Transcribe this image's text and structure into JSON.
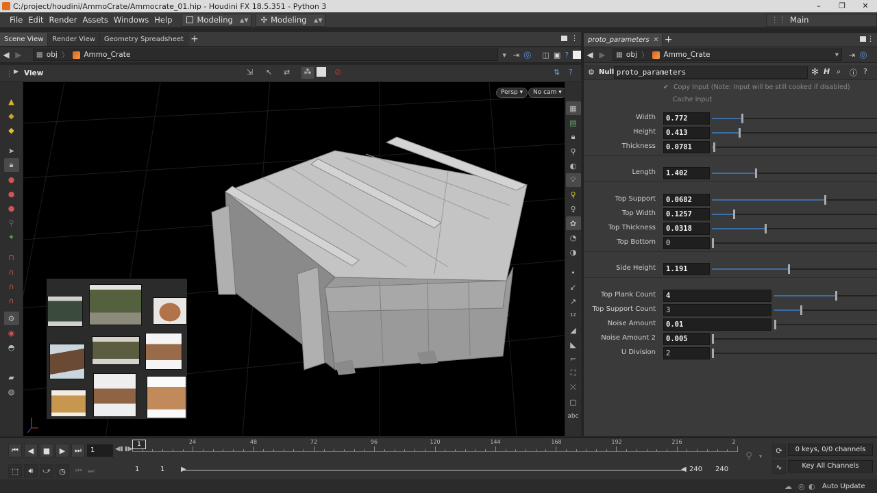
{
  "titlebar": {
    "title": "C:/project/houdini/AmmoCrate/Ammocrate_01.hip - Houdini FX 18.5.351 - Python 3",
    "min": "–",
    "max": "❐",
    "close": "✕"
  },
  "menubar": {
    "items": [
      "File",
      "Edit",
      "Render",
      "Assets",
      "Windows",
      "Help"
    ],
    "desktop": "Modeling",
    "shelf": "Modeling",
    "main": "Main"
  },
  "scene_tabs": [
    "Scene View",
    "Render View",
    "Geometry Spreadsheet"
  ],
  "scene_path": {
    "root": "obj",
    "node": "Ammo_Crate"
  },
  "view": {
    "label": "View",
    "persp": "Persp ▾",
    "cam": "No cam ▾"
  },
  "param_tab": "proto_parameters",
  "param_path": {
    "root": "obj",
    "node": "Ammo_Crate"
  },
  "node": {
    "type": "Null",
    "name": "proto_parameters"
  },
  "toggles": {
    "copy_input": "Copy Input (Note: Input will be still cooked if disabled)",
    "cache_input": "Cache Input"
  },
  "params": {
    "width": {
      "label": "Width",
      "value": "0.772",
      "frac": 0.18
    },
    "height": {
      "label": "Height",
      "value": "0.413",
      "frac": 0.16
    },
    "thickness": {
      "label": "Thickness",
      "value": "0.0781",
      "frac": 0.01
    },
    "length": {
      "label": "Length",
      "value": "1.402",
      "frac": 0.26
    },
    "top_support": {
      "label": "Top Support",
      "value": "0.0682",
      "frac": 0.68
    },
    "top_width": {
      "label": "Top Width",
      "value": "0.1257",
      "frac": 0.13
    },
    "top_thickness": {
      "label": "Top Thickness",
      "value": "0.0318",
      "frac": 0.32
    },
    "top_bottom": {
      "label": "Top Bottom",
      "value": "0",
      "frac": 0.0
    },
    "side_height": {
      "label": "Side Height",
      "value": "1.191",
      "frac": 0.46
    },
    "top_plank_count": {
      "label": "Top Plank Count",
      "value": "4",
      "frac": 0.59
    },
    "top_support_count": {
      "label": "Top Support Count",
      "value": "3",
      "frac": 0.25
    },
    "noise_amount": {
      "label": "Noise Amount",
      "value": "0.01",
      "frac": 0.0
    },
    "noise_amount_2": {
      "label": "Noise Amount 2",
      "value": "0.005",
      "frac": 0.0
    },
    "u_division": {
      "label": "U Division",
      "value": "2",
      "frac": 0.0
    }
  },
  "timeline": {
    "current_frame": "1",
    "marker": "1",
    "ticks": [
      "24",
      "48",
      "72",
      "96",
      "120",
      "144",
      "168",
      "192",
      "216",
      "2"
    ],
    "start": "1",
    "start2": "1",
    "end": "240",
    "end2": "240",
    "keys": "0 keys, 0/0 channels",
    "key_all": "Key All Channels",
    "auto_update": "Auto Update"
  },
  "abc_label": "abc",
  "colors": {
    "accent": "#3b6ea5",
    "viewport_bg": "#000000",
    "panel": "#3a3a3a"
  }
}
